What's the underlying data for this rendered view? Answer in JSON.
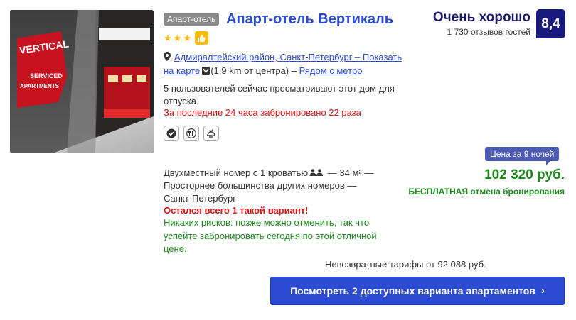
{
  "listing": {
    "type_badge": "Апарт-отель",
    "name": "Апарт-отель Вертикаль",
    "stars": 3,
    "location_link_part1": "Адмиралтейский район, Санкт-Петербург – Показать",
    "location_link_part2": "на карте",
    "distance": "(1,9 km от центра)",
    "metro_sep": " – ",
    "metro": "Рядом с метро",
    "viewers": "5 пользователей сейчас просматривают этот дом для отпуска",
    "booked": "За последние 24 часа забронировано 22 раза",
    "facilities": [
      "verified-icon",
      "restaurant-icon",
      "breakfast-icon"
    ],
    "photo_sign": [
      "VERTICAL",
      "SERVICED",
      "APARTMENTS"
    ]
  },
  "review": {
    "word": "Очень хорошо",
    "count": "1 730 отзывов гостей",
    "score": "8,4"
  },
  "pricing": {
    "period": "Цена за 9 ночей",
    "price": "102 320 руб.",
    "free_cancel": "БЕСПЛАТНАЯ отмена бронирования",
    "nonrefundable": "Невозвратные тарифы от 92 088 руб."
  },
  "room": {
    "desc_part1": "Двухместный номер с 1 кроватью",
    "desc_part2": " — 34 м² — Просторнее большинства других номеров — Санкт-Петербург",
    "last_one": "Остался всего 1 такой вариант!",
    "no_risk": "Никаких рисков: позже можно отменить, так что успейте забронировать сегодня по этой отличной цене."
  },
  "cta": {
    "label": "Посмотреть 2 доступных варианта апартаментов",
    "icon": "chevron-right-icon"
  },
  "colors": {
    "link": "#2a4bd2",
    "score_bg": "#1a1a7c",
    "price": "#1d8a1d",
    "urgent": "#e21111",
    "star": "#febb02"
  }
}
